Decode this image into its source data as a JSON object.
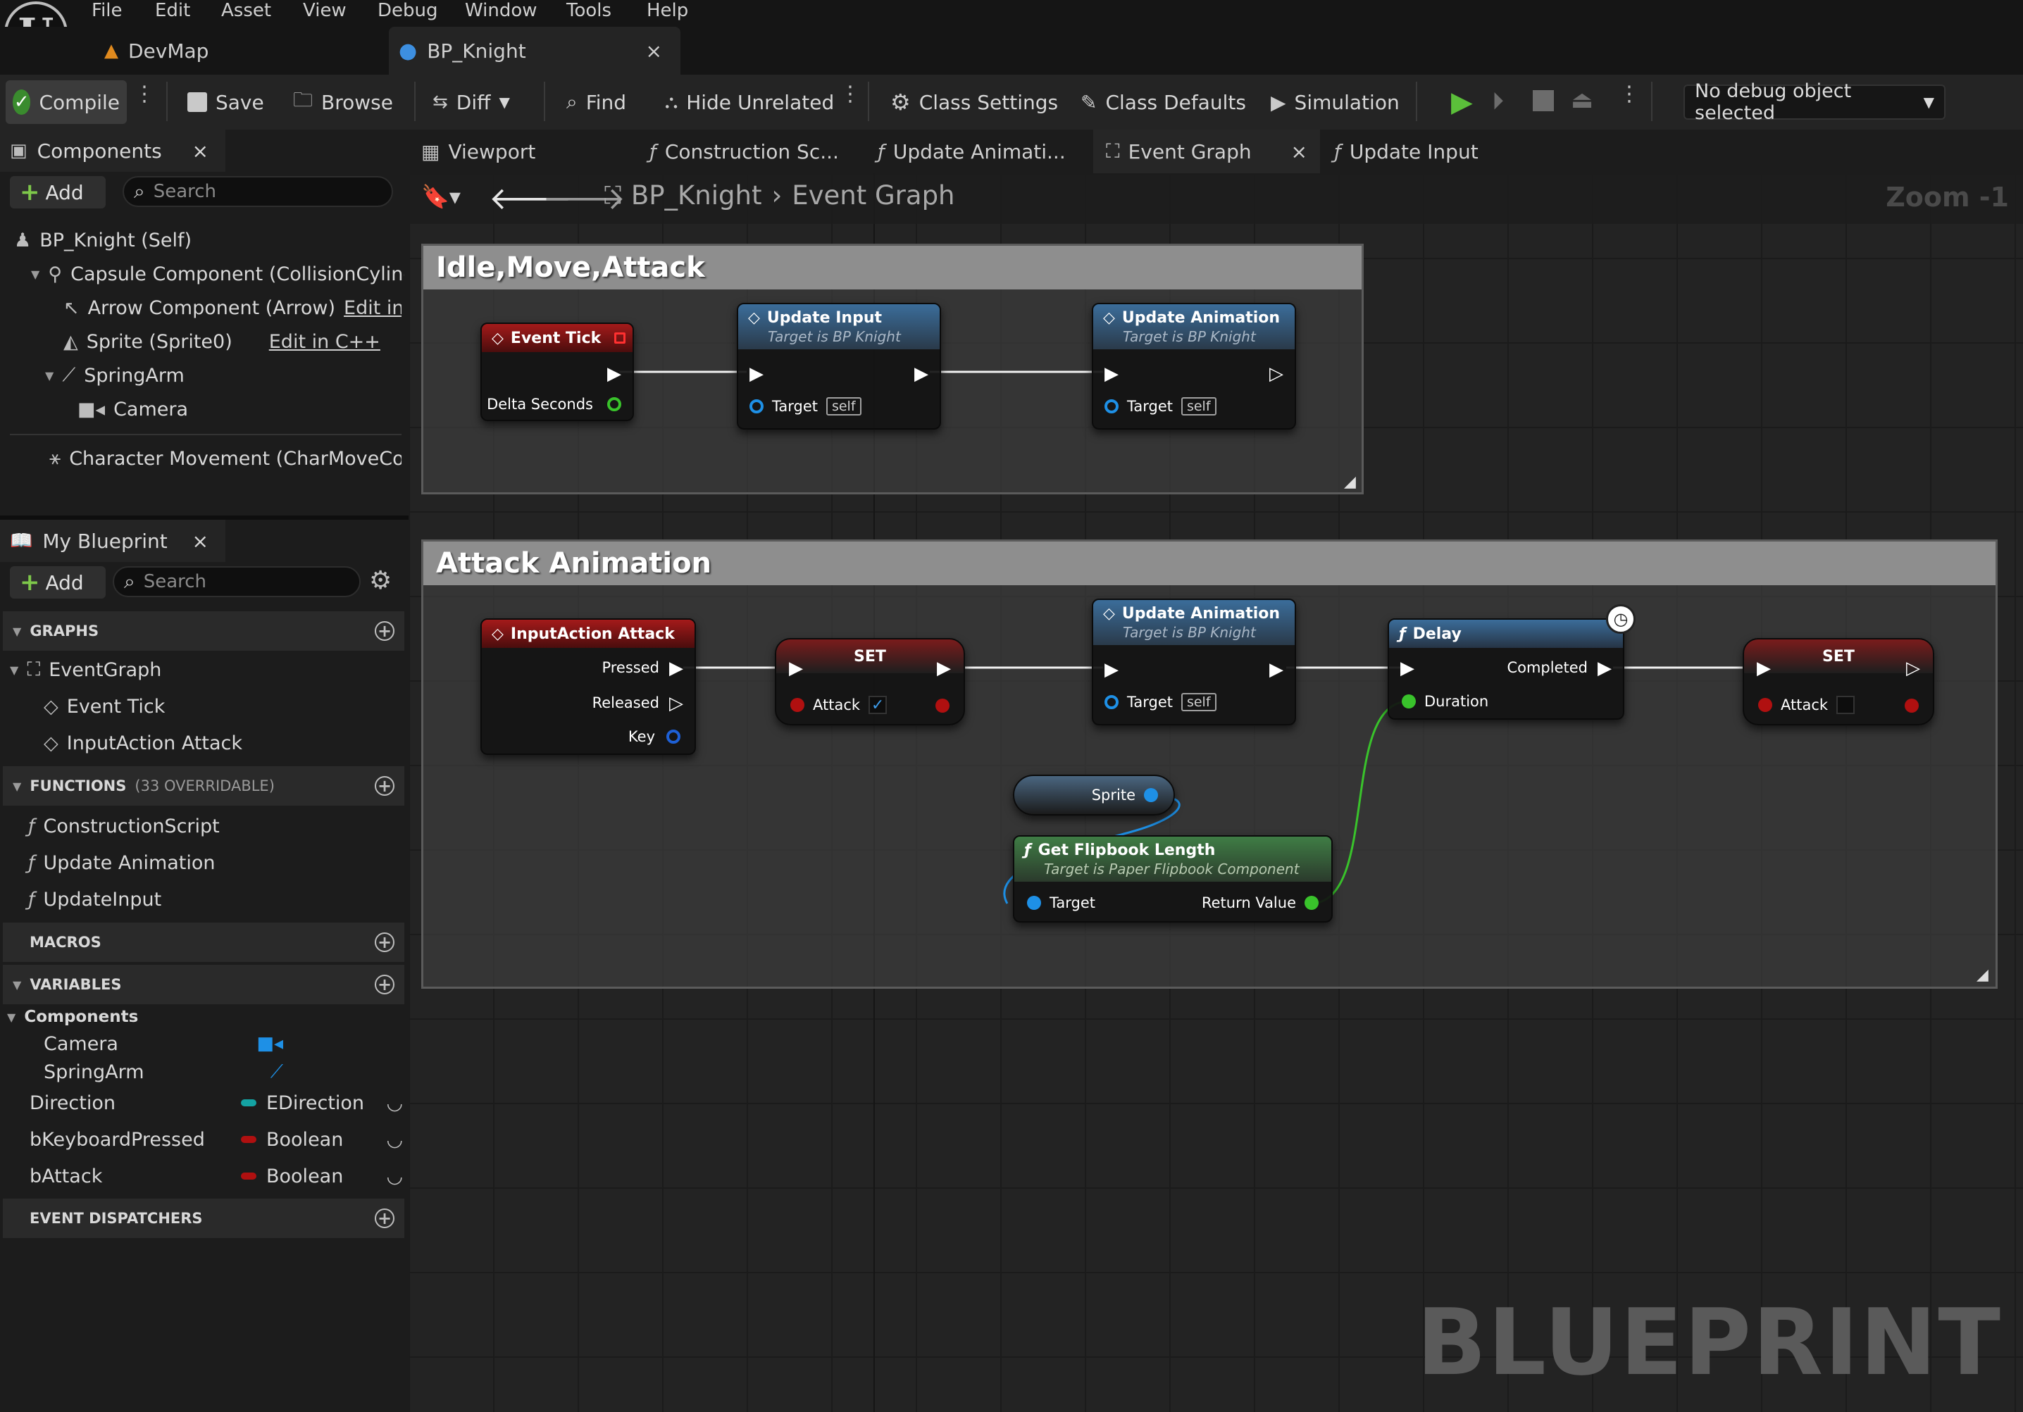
{
  "menu": [
    "File",
    "Edit",
    "Asset",
    "View",
    "Debug",
    "Window",
    "Tools",
    "Help"
  ],
  "doc_tabs": [
    {
      "label": "DevMap"
    },
    {
      "label": "BP_Knight",
      "close": "×"
    }
  ],
  "toolbar": {
    "compile": "Compile",
    "save": "Save",
    "browse": "Browse",
    "diff": "Diff",
    "find": "Find",
    "hide_unrelated": "Hide Unrelated",
    "class_settings": "Class Settings",
    "class_defaults": "Class Defaults",
    "simulation": "Simulation",
    "debug_select": "No debug object selected"
  },
  "components_panel": {
    "title": "Components",
    "close": "×",
    "add": "Add",
    "search_placeholder": "Search",
    "items": [
      {
        "label": "BP_Knight (Self)",
        "edit": ""
      },
      {
        "label": "Capsule Component (CollisionCylinde",
        "edit": ""
      },
      {
        "label": "Arrow Component (Arrow)",
        "edit": "Edit in C"
      },
      {
        "label": "Sprite (Sprite0)",
        "edit": "Edit in C++"
      },
      {
        "label": "SpringArm",
        "edit": ""
      },
      {
        "label": "Camera",
        "edit": ""
      },
      {
        "label": "Character Movement (CharMoveComp",
        "edit": ""
      }
    ]
  },
  "my_blueprint": {
    "title": "My Blueprint",
    "close": "×",
    "add": "Add",
    "search_placeholder": "Search",
    "graphs_header": "GRAPHS",
    "graphs": [
      "EventGraph",
      "Event Tick",
      "InputAction Attack"
    ],
    "functions_header": "FUNCTIONS",
    "functions_note": "(33 OVERRIDABLE)",
    "functions": [
      "ConstructionScript",
      "Update Animation",
      "UpdateInput"
    ],
    "macros_header": "MACROS",
    "variables_header": "VARIABLES",
    "components_group": "Components",
    "component_vars": [
      "Camera",
      "SpringArm"
    ],
    "variables": [
      {
        "name": "Direction",
        "type": "EDirection",
        "color": "#14a3a3"
      },
      {
        "name": "bKeyboardPressed",
        "type": "Boolean",
        "color": "#b01010"
      },
      {
        "name": "bAttack",
        "type": "Boolean",
        "color": "#b01010"
      }
    ],
    "dispatchers_header": "EVENT DISPATCHERS"
  },
  "graph_tabs": [
    {
      "label": "Viewport"
    },
    {
      "label": "Construction Sc..."
    },
    {
      "label": "Update Animati..."
    },
    {
      "label": "Event Graph",
      "close": "×"
    },
    {
      "label": "Update Input"
    }
  ],
  "breadcrumb": {
    "root": "BP_Knight",
    "current": "Event Graph"
  },
  "zoom": "Zoom -1",
  "watermark": "BLUEPRINT",
  "comments": [
    {
      "title": "Idle,Move,Attack"
    },
    {
      "title": "Attack Animation"
    }
  ],
  "nodes": {
    "event_tick": {
      "title": "Event Tick",
      "pin": "Delta Seconds"
    },
    "update_input": {
      "title": "Update Input",
      "sub": "Target is BP Knight",
      "pin": "Target",
      "self": "self"
    },
    "update_anim_1": {
      "title": "Update Animation",
      "sub": "Target is BP Knight",
      "pin": "Target",
      "self": "self"
    },
    "input_attack": {
      "title": "InputAction Attack",
      "pressed": "Pressed",
      "released": "Released",
      "key": "Key"
    },
    "set_1": {
      "title": "SET",
      "pin": "Attack"
    },
    "update_anim_2": {
      "title": "Update Animation",
      "sub": "Target is BP Knight",
      "pin": "Target",
      "self": "self"
    },
    "delay": {
      "title": "Delay",
      "completed": "Completed",
      "duration": "Duration"
    },
    "set_2": {
      "title": "SET",
      "pin": "Attack"
    },
    "sprite": {
      "title": "Sprite"
    },
    "flipbook": {
      "title": "Get Flipbook Length",
      "sub": "Target is Paper Flipbook Component",
      "target": "Target",
      "ret": "Return Value"
    }
  },
  "colors": {
    "accent_green": "#5bbf3a",
    "exec": "#ffffff",
    "bool_pin": "#b01010",
    "object_pin": "#1e90e6",
    "float_pin": "#39c32b"
  }
}
